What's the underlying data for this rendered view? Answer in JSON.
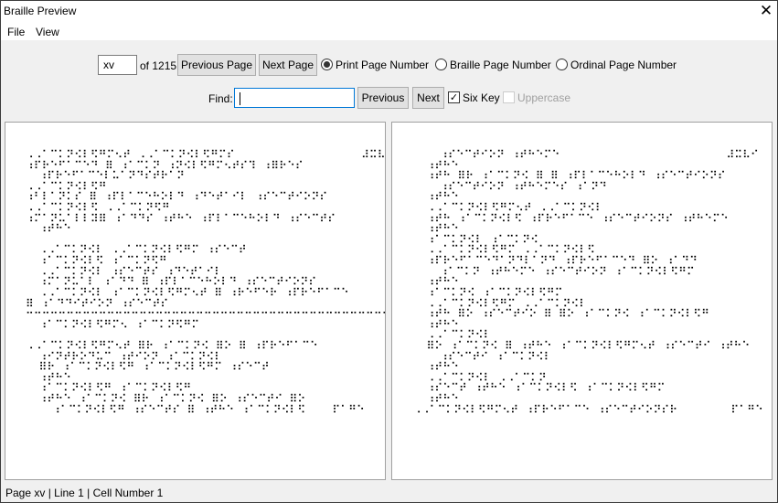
{
  "window": {
    "title": "Braille Preview",
    "close_icon": "close-icon"
  },
  "menu": {
    "items": [
      "File",
      "View"
    ]
  },
  "toolbar": {
    "page_value": "xv",
    "page_of": "of 1215",
    "previous_page": "Previous Page",
    "next_page": "Next Page",
    "radios": [
      {
        "label": "Print Page Number",
        "selected": true
      },
      {
        "label": "Braille Page Number",
        "selected": false
      },
      {
        "label": "Ordinal Page Number",
        "selected": false
      }
    ],
    "find_label": "Find:",
    "find_value": "",
    "previous": "Previous",
    "next": "Next",
    "six_key": {
      "label": "Six Key",
      "checked": true
    },
    "uppercase": {
      "label": "Uppercase",
      "checked": false,
      "disabled": true
    }
  },
  "left_page": {
    "lines": [
      "⠠⠠⠁⠉⠅⠝⠪⠇⠫⠛⠍⠢⠞ ⠠⠠⠁⠉⠅⠝⠪⠇⠫⠛⠍⠎                   ⠼⠭⠧",
      "⠰⠏⠗⠑⠋⠁⠉⠑⠙ ⠿ ⠰⠁⠉⠅⠝ ⠰⠝⠪⠇⠫⠛⠍⠢⠞⠎⠹ ⠰⠿⠗⠑⠎",
      "  ⠰⠏⠗⠑⠋⠁⠉⠑⠇⠥⠁⠝⠙⠎⠞⠗⠁⠝",
      "⠠⠠⠁⠉⠅⠝⠪⠇⠫⠛",
      "⠰⠃⠇⠁⠝⠅⠎ ⠿ ⠰⠏⠇⠁⠉⠑⠓⠕⠇⠙ ⠰⠙⠑⠞⠁⠊⠇ ⠰⠎⠑⠉⠞⠊⠕⠝⠎",
      "⠠⠠⠁⠉⠅⠝⠪⠇⠫ ⠠⠠⠁⠉⠅⠝⠫⠛",
      "⠰⠍⠁⠝⠥⠁⠇⠇⠽⠿ ⠰⠁⠙⠙⠎ ⠰⠞⠓⠑ ⠰⠏⠇⠁⠉⠑⠓⠕⠇⠙ ⠰⠎⠑⠉⠞⠎",
      "  ⠰⠞⠓⠑",
      "",
      "  ⠠⠠⠁⠉⠅⠝⠪⠇ ⠠⠠⠁⠉⠅⠝⠪⠇⠫⠛⠍ ⠰⠎⠑⠉⠞",
      "  ⠰⠁⠉⠅⠝⠪⠇⠫ ⠰⠁⠉⠅⠝⠫⠛",
      "  ⠠⠠⠁⠉⠅⠝⠪⠇ ⠰⠎⠑⠉⠞⠎ ⠰⠙⠑⠞⠁⠊⠇",
      "  ⠰⠍⠁⠝⠥⠁⠇ ⠰⠁⠙⠙ ⠿ ⠰⠏⠇⠁⠉⠑⠓⠕⠇⠙ ⠰⠎⠑⠉⠞⠊⠕⠝⠎",
      "  ⠠⠠⠁⠉⠅⠝⠪⠇ ⠰⠁⠉⠅⠝⠪⠇⠫⠛⠍⠢⠞ ⠿ ⠰⠗⠑⠋⠑⠗ ⠰⠏⠗⠑⠋⠁⠉⠑",
      "⠿ ⠰⠁⠙⠙⠊⠞⠊⠕⠝ ⠰⠎⠑⠉⠞⠎",
      "⠒⠒⠒⠒⠒⠒⠒⠒⠒⠒⠒⠒⠒⠒⠒⠒⠒⠒⠒⠒⠒⠒⠒⠒⠒⠒⠒⠒⠒⠒⠒⠒⠒⠒⠒⠒⠒⠒⠒⠒⠒⠒⠒⠒⠒⠒⠒⠒⠒⠒",
      "  ⠰⠁⠉⠅⠝⠪⠇⠫⠛⠍⠢ ⠰⠁⠉⠅⠝⠫⠛⠍",
      "",
      "⠠⠠⠁⠉⠅⠝⠪⠇⠫⠛⠍⠢⠞ ⠿⠗ ⠰⠁⠉⠅⠝⠪ ⠿⠕ ⠿ ⠰⠏⠗⠑⠋⠁⠉⠑",
      "  ⠰⠊⠝⠞⠗⠕⠙⠥⠉ ⠰⠞⠊⠕⠝ ⠰⠁⠉⠅⠝⠪⠇",
      "  ⠿⠗ ⠰⠁⠉⠅⠝⠪⠇⠫⠛ ⠰⠁⠉⠅⠝⠪⠇⠫⠛⠍ ⠰⠎⠑⠉⠞",
      "  ⠰⠞⠓⠑",
      "  ⠰⠁⠉⠅⠝⠪⠇⠫⠛ ⠰⠁⠉⠅⠝⠪⠇⠫⠛",
      "  ⠰⠞⠓⠑ ⠰⠁⠉⠅⠝⠪ ⠿⠗ ⠰⠁⠉⠅⠝⠪ ⠿⠕ ⠰⠎⠑⠉⠞⠊ ⠿⠕",
      "    ⠰⠁⠉⠅⠝⠪⠇⠫⠛ ⠰⠎⠑⠉⠞⠎ ⠿ ⠰⠞⠓⠑ ⠰⠁⠉⠅⠝⠪⠇⠫    ⠏⠁⠛⠑"
    ]
  },
  "right_page": {
    "lines": [
      "    ⠰⠎⠑⠉⠞⠊⠕⠝ ⠰⠞⠓⠑⠍⠑                         ⠼⠭⠧⠊",
      "  ⠰⠞⠓⠑",
      "  ⠰⠞⠓ ⠿⠗ ⠰⠁⠉⠅⠝⠪ ⠿ ⠿ ⠰⠏⠇⠁⠉⠑⠓⠕⠇⠙ ⠰⠎⠑⠉⠞⠊⠕⠝⠎",
      "    ⠰⠎⠑⠉⠞⠊⠕⠝ ⠰⠞⠓⠑⠍⠑⠎ ⠰⠁⠝⠙",
      "  ⠰⠞⠓⠑",
      "  ⠠⠠⠁⠉⠅⠝⠪⠇⠫⠛⠍⠢⠞ ⠠⠠⠁⠉⠅⠝⠪⠇",
      "  ⠰⠞⠓ ⠰⠁⠉⠅⠝⠪⠇⠫ ⠰⠏⠗⠑⠋⠁⠉⠑ ⠰⠎⠑⠉⠞⠊⠕⠝⠎ ⠰⠞⠓⠑⠍⠑",
      "  ⠰⠞⠓⠑",
      "  ⠰⠁⠉⠅⠝⠪⠇ ⠰⠁⠉⠅⠝⠪",
      "  ⠠⠠⠁⠉⠅⠝⠪⠇⠫⠛⠍ ⠠⠠⠁⠉⠅⠝⠪⠇⠫",
      "  ⠰⠏⠗⠑⠋⠁⠉⠑⠙⠁⠝⠙⠇⠁⠝⠙ ⠰⠏⠗⠑⠋⠁⠉⠑⠙ ⠿⠕ ⠰⠁⠙⠙",
      "    ⠰⠁⠉⠅⠝ ⠰⠞⠓⠑⠍⠑ ⠰⠎⠑⠉⠞⠊⠕⠝ ⠰⠁⠉⠅⠝⠪⠇⠫⠛⠍",
      "  ⠰⠞⠓⠑",
      "  ⠰⠁⠉⠅⠝⠪ ⠰⠁⠉⠅⠝⠪⠇⠫⠛⠍",
      "  ⠠⠠⠁⠉⠅⠝⠪⠇⠫⠛⠍ ⠠⠠⠁⠉⠅⠝⠪⠇",
      "  ⠰⠞⠓ ⠿⠕ ⠰⠎⠑⠉⠞⠊⠕ ⠿ ⠿⠕ ⠰⠁⠉⠅⠝⠪ ⠰⠁⠉⠅⠝⠪⠇⠫⠛",
      "  ⠰⠞⠓⠑",
      "  ⠠⠠⠁⠉⠅⠝⠪⠇",
      "  ⠿⠕ ⠰⠁⠉⠅⠝⠪ ⠿ ⠰⠞⠓⠑ ⠰⠁⠉⠅⠝⠪⠇⠫⠛⠍⠢⠞ ⠰⠎⠑⠉⠞⠊ ⠰⠞⠓⠑",
      "    ⠰⠎⠑⠉⠞⠊ ⠰⠁⠉⠅⠝⠪⠇",
      "  ⠰⠞⠓⠑",
      "  ⠠⠠⠁⠉⠅⠝⠪⠇ ⠠⠠⠁⠉⠅⠝",
      "  ⠰⠎⠑⠉⠞ ⠰⠞⠓⠑ ⠰⠁⠉⠅⠝⠪⠇⠫ ⠰⠁⠉⠅⠝⠪⠇⠫⠛⠍",
      "  ⠰⠞⠓⠑",
      "⠠⠠⠁⠉⠅⠝⠪⠇⠫⠛⠍⠢⠞ ⠰⠏⠗⠑⠋⠁⠉⠑ ⠰⠎⠑⠉⠞⠊⠕⠝⠎⠗        ⠏⠁⠛⠑"
    ]
  },
  "status_bar": {
    "text": "Page xv | Line 1 | Cell Number 1"
  }
}
